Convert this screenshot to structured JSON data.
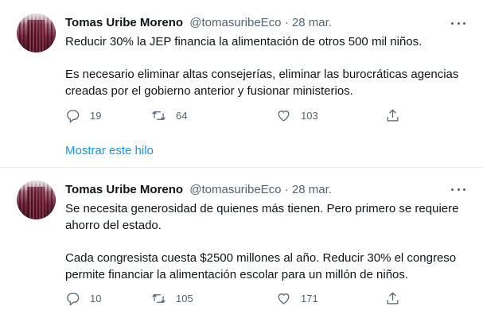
{
  "tweets": [
    {
      "name": "Tomas Uribe Moreno",
      "handle": "@tomasuribeEco",
      "separator": "·",
      "date": "28 mar.",
      "paragraphs": [
        "Reducir 30% la JEP financia la alimentación de otros 500 mil niños.",
        "Es necesario eliminar altas consejerías, eliminar las burocráticas agencias creadas por el gobierno anterior y fusionar ministerios."
      ],
      "replies": "19",
      "retweets": "64",
      "likes": "103",
      "show_thread": "Mostrar este hilo"
    },
    {
      "name": "Tomas Uribe Moreno",
      "handle": "@tomasuribeEco",
      "separator": "·",
      "date": "28 mar.",
      "paragraphs": [
        "Se necesita generosidad de quienes más tienen. Pero primero se requiere ahorro del estado.",
        "Cada congresista cuesta $2500 millones al año. Reducir 30% el congreso permite financiar la alimentación escolar para un millón de niños."
      ],
      "replies": "10",
      "retweets": "105",
      "likes": "171"
    }
  ],
  "icons": {
    "reply": "reply-icon",
    "retweet": "retweet-icon",
    "like": "heart-icon",
    "share": "share-icon",
    "more": "more-icon"
  },
  "colors": {
    "text": "#0f1419",
    "secondary": "#536471",
    "link": "#1b95e0",
    "divider": "#ebeef0"
  }
}
